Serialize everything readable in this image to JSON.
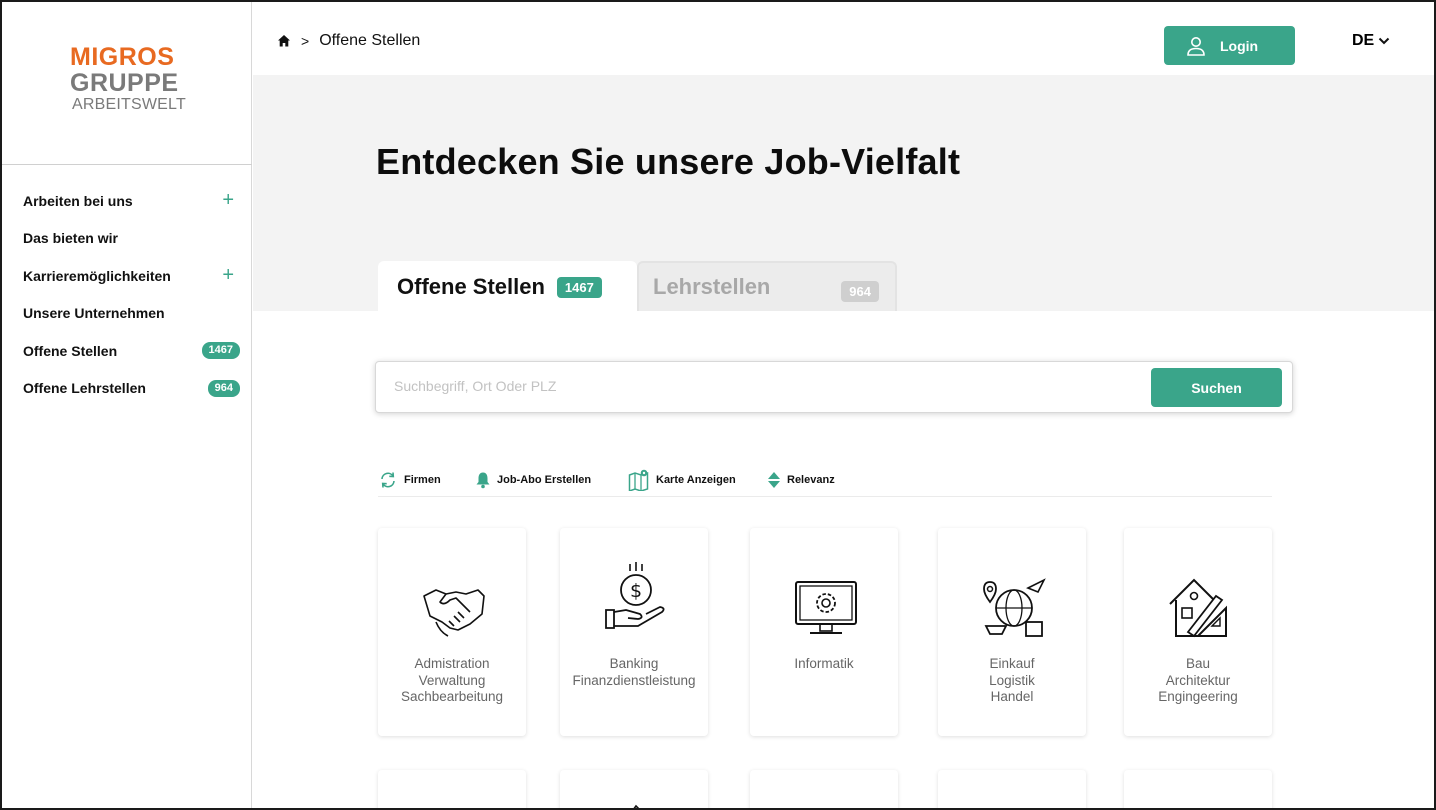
{
  "logo": {
    "line1": "MIGROS",
    "line2": "GRUPPE",
    "line3": "ARBEITSWELT"
  },
  "sidebar": {
    "items": [
      {
        "label": "Arbeiten bei uns",
        "expand": "+"
      },
      {
        "label": "Das bieten wir"
      },
      {
        "label": "Karrieremöglichkeiten",
        "expand": "+"
      },
      {
        "label": "Unsere Unternehmen"
      },
      {
        "label": "Offene Stellen",
        "count": "1467"
      },
      {
        "label": "Offene Lehrstellen",
        "count": "964"
      }
    ]
  },
  "header": {
    "breadcrumb_sep": ">",
    "breadcrumb_current": "Offene Stellen",
    "login_label": "Login",
    "language": "DE"
  },
  "hero": {
    "title": "Entdecken Sie unsere Job-Vielfalt"
  },
  "tabs": [
    {
      "label": "Offene Stellen",
      "count": "1467",
      "active": true
    },
    {
      "label": "Lehrstellen",
      "count": "964",
      "active": false
    }
  ],
  "search": {
    "placeholder": "Suchbegriff, Ort Oder PLZ",
    "button_label": "Suchen"
  },
  "filters": [
    {
      "label": "Firmen",
      "icon": "refresh-icon"
    },
    {
      "label": "Job-Abo Erstellen",
      "icon": "bell-icon"
    },
    {
      "label": "Karte Anzeigen",
      "icon": "map-icon"
    },
    {
      "label": "Relevanz",
      "icon": "sort-icon"
    }
  ],
  "categories": [
    {
      "lines": [
        "Admistration",
        "Verwaltung",
        "Sachbearbeitung"
      ],
      "icon": "handshake-icon"
    },
    {
      "lines": [
        "Banking",
        "Finanzdienstleistung"
      ],
      "icon": "money-hand-icon"
    },
    {
      "lines": [
        "Informatik"
      ],
      "icon": "monitor-gear-icon"
    },
    {
      "lines": [
        "Einkauf",
        "Logistik",
        "Handel"
      ],
      "icon": "globe-logistics-icon"
    },
    {
      "lines": [
        "Bau",
        "Architektur",
        "Engingeering"
      ],
      "icon": "house-tools-icon"
    }
  ],
  "colors": {
    "accent": "#3aa58a",
    "brand_orange": "#e86a21",
    "brand_grey": "#7a7a7a"
  }
}
